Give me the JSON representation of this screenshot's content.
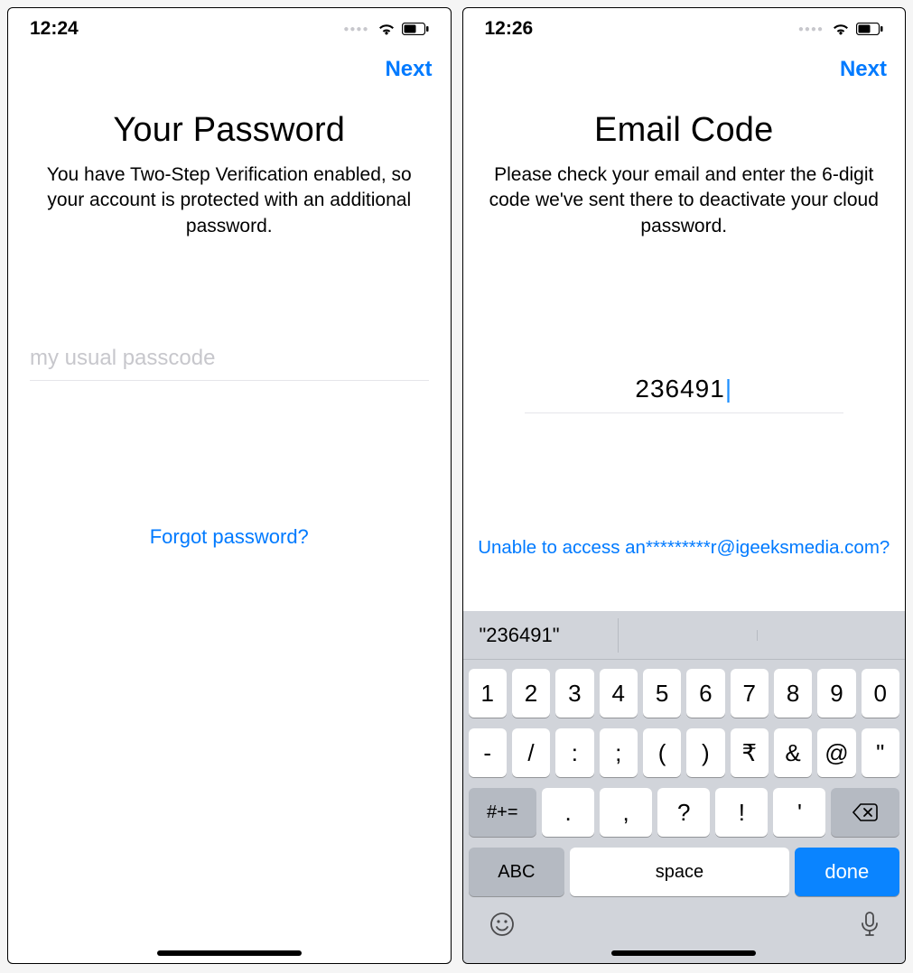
{
  "left": {
    "time": "12:24",
    "nav_next": "Next",
    "title": "Your Password",
    "desc": "You have Two-Step Verification enabled, so your account is protected with an additional password.",
    "input_placeholder": "my usual passcode",
    "forgot": "Forgot password?"
  },
  "right": {
    "time": "12:26",
    "nav_next": "Next",
    "title": "Email Code",
    "desc": "Please check your email and enter the 6-digit code we've sent there to deactivate your cloud password.",
    "code_value": "236491",
    "unable_link": "Unable to access an*********r@igeeksmedia.com?",
    "suggestion": "\"236491\"",
    "keys_row1": [
      "1",
      "2",
      "3",
      "4",
      "5",
      "6",
      "7",
      "8",
      "9",
      "0"
    ],
    "keys_row2": [
      "-",
      "/",
      ":",
      ";",
      "(",
      ")",
      "₹",
      "&",
      "@",
      "\""
    ],
    "keys_row3_mode": "#+=",
    "keys_row3": [
      ".",
      ",",
      "?",
      "!",
      "'"
    ],
    "abc": "ABC",
    "space": "space",
    "done": "done"
  }
}
